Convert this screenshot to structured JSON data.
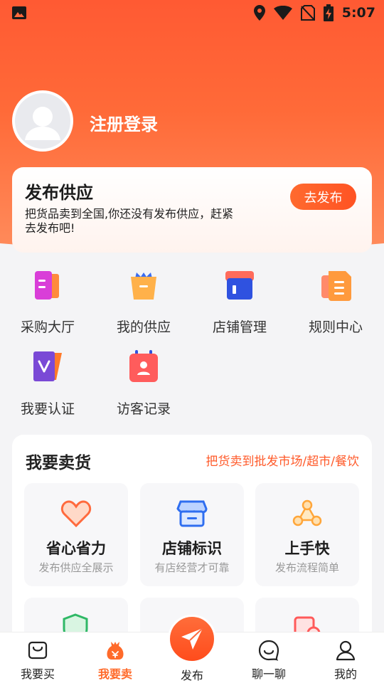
{
  "status_bar": {
    "time": "5:07"
  },
  "profile": {
    "login_label": "注册登录"
  },
  "publish_card": {
    "title": "发布供应",
    "description": "把货品卖到全国,你还没有发布供应，赶紧去发布吧!",
    "button_label": "去发布"
  },
  "grid": [
    {
      "label": "采购大厅",
      "icon": "purchase-hall-icon"
    },
    {
      "label": "我的供应",
      "icon": "my-supply-icon"
    },
    {
      "label": "店铺管理",
      "icon": "store-management-icon"
    },
    {
      "label": "规则中心",
      "icon": "rules-center-icon"
    },
    {
      "label": "我要认证",
      "icon": "verification-icon"
    },
    {
      "label": "访客记录",
      "icon": "visitor-record-icon"
    }
  ],
  "sell_section": {
    "title": "我要卖货",
    "link": "把货卖到批发市场/超市/餐饮",
    "features": [
      {
        "title": "省心省力",
        "subtitle": "发布供应全展示",
        "icon": "heart-icon"
      },
      {
        "title": "店铺标识",
        "subtitle": "有店经营才可靠",
        "icon": "shop-sign-icon"
      },
      {
        "title": "上手快",
        "subtitle": "发布流程简单",
        "icon": "network-icon"
      }
    ]
  },
  "tabbar": {
    "items": [
      {
        "label": "我要买",
        "icon": "shopping-bag-icon"
      },
      {
        "label": "我要卖",
        "icon": "money-bag-icon",
        "active": true
      },
      {
        "label": "发布",
        "icon": "paper-plane-icon"
      },
      {
        "label": "聊一聊",
        "icon": "chat-face-icon"
      },
      {
        "label": "我的",
        "icon": "user-icon"
      }
    ]
  },
  "colors": {
    "accent": "#ff5a2a",
    "header_top": "#ff5a33",
    "header_bottom": "#ff8a5a"
  }
}
